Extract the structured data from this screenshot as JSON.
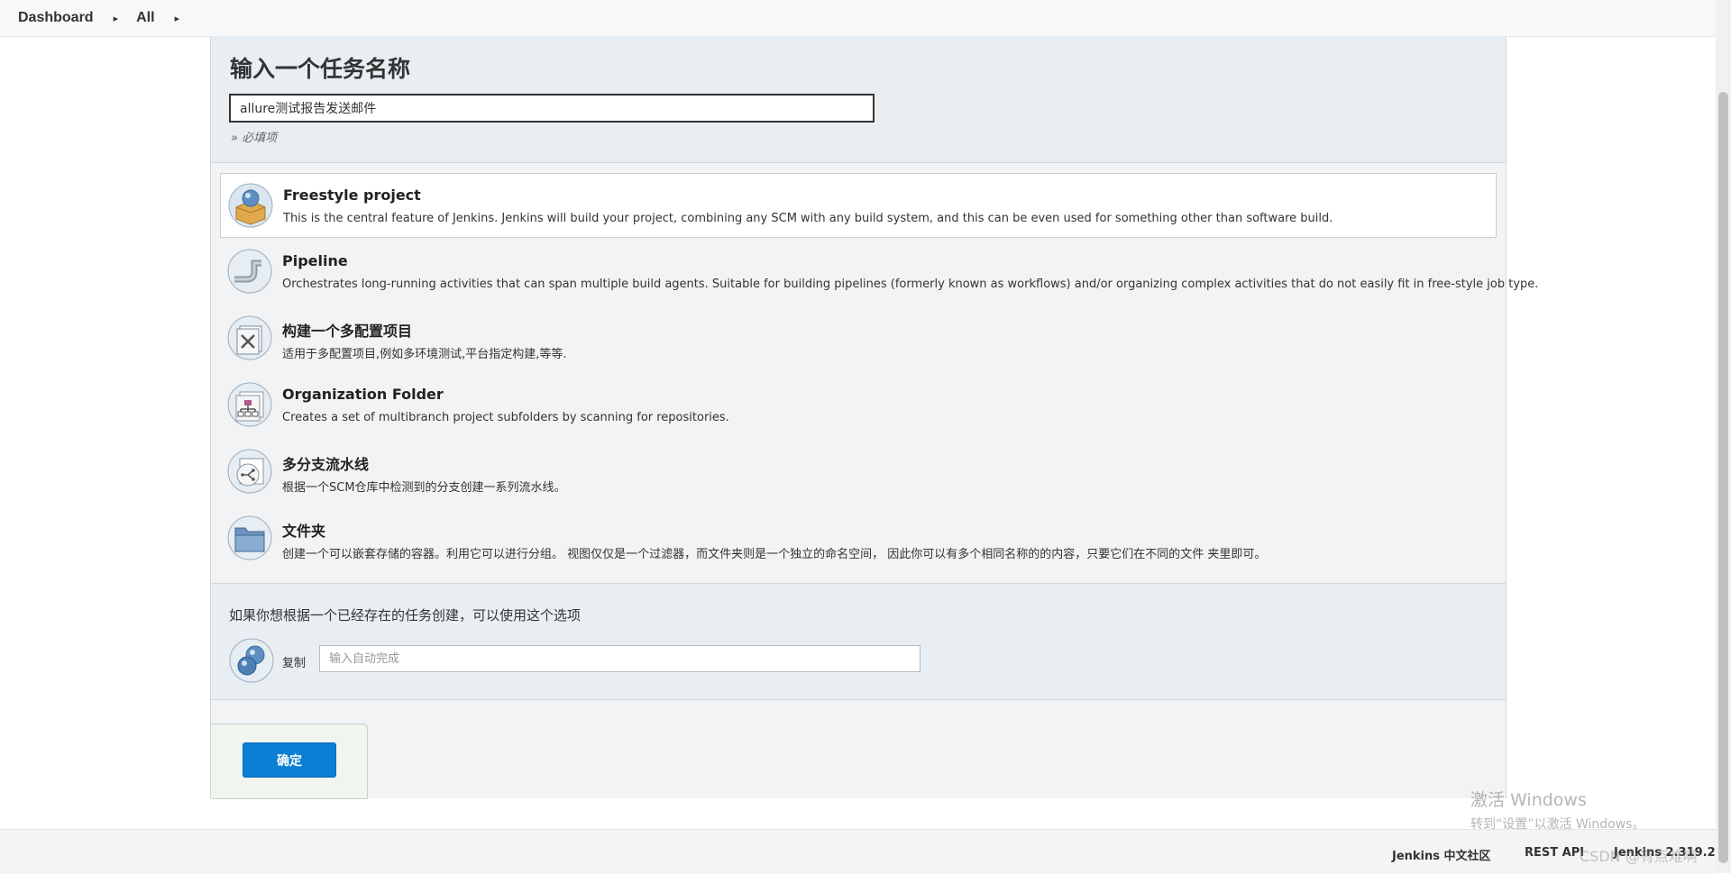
{
  "breadcrumb": {
    "items": [
      "Dashboard",
      "All"
    ]
  },
  "new_item": {
    "title": "输入一个任务名称",
    "name_value": "allure测试报告发送邮件",
    "required_note": "» 必填项"
  },
  "item_types": [
    {
      "title": "Freestyle project",
      "description": "This is the central feature of Jenkins. Jenkins will build your project, combining any SCM with any build system, and this can be even used for something other than software build.",
      "icon": "freestyle-box-icon",
      "selected": true
    },
    {
      "title": "Pipeline",
      "description": "Orchestrates long-running activities that can span multiple build agents. Suitable for building pipelines (formerly known as workflows) and/or organizing complex activities that do not easily fit in free-style job type.",
      "icon": "pipeline-icon"
    },
    {
      "title": "构建一个多配置项目",
      "description": "适用于多配置项目,例如多环境测试,平台指定构建,等等.",
      "icon": "multi-config-icon"
    },
    {
      "title": "Organization Folder",
      "description": "Creates a set of multibranch project subfolders by scanning for repositories.",
      "icon": "organization-folder-icon"
    },
    {
      "title": "多分支流水线",
      "description": "根据一个SCM仓库中检测到的分支创建一系列流水线。",
      "icon": "multibranch-pipeline-icon"
    },
    {
      "title": "文件夹",
      "description": "创建一个可以嵌套存储的容器。利用它可以进行分组。 视图仅仅是一个过滤器，而文件夹则是一个独立的命名空间， 因此你可以有多个相同名称的的内容，只要它们在不同的文件 夹里即可。",
      "icon": "folder-icon"
    }
  ],
  "copy_from": {
    "hint": "如果你想根据一个已经存在的任务创建，可以使用这个选项",
    "label": "复制",
    "placeholder": "输入自动完成"
  },
  "ok_button": "确定",
  "footer": {
    "community_link": "Jenkins 中文社区",
    "rest_api_link": "REST API",
    "version": "Jenkins 2.319.2"
  },
  "overlay": {
    "activate_title": "激活 Windows",
    "activate_sub": "转到“设置”以激活 Windows。",
    "watermark": "CSDN @有点难啊"
  },
  "colors": {
    "accent": "#0b7fd4",
    "section_bg": "#e9eef2"
  }
}
